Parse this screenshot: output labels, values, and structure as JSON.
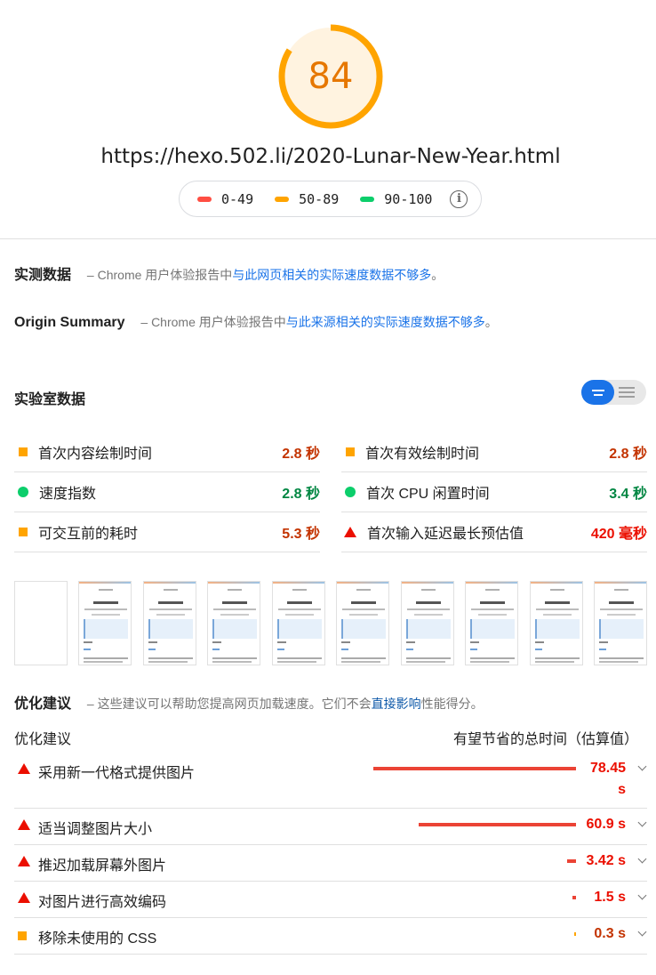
{
  "score": {
    "value": "84",
    "fraction": 0.84,
    "color": "#ffa400",
    "fill": "#fff3e0"
  },
  "url": "https://hexo.502.li/2020-Lunar-New-Year.html",
  "legend": [
    {
      "label": "0-49",
      "color": "#ff4e42"
    },
    {
      "label": "50-89",
      "color": "#ffa400"
    },
    {
      "label": "90-100",
      "color": "#0cce6b"
    }
  ],
  "field_data": {
    "title": "实测数据",
    "dash": "–",
    "text": "Chrome 用户体验报告中",
    "link": "与此网页相关的实际速度数据不够多",
    "end": "。"
  },
  "origin_summary": {
    "title": "Origin Summary",
    "dash": "–",
    "text": "Chrome 用户体验报告中",
    "link": "与此来源相关的实际速度数据不够多",
    "end": "。"
  },
  "lab_data": {
    "title": "实验室数据",
    "metrics_left": [
      {
        "label": "首次内容绘制时间",
        "value": "2.8 秒",
        "status": "average"
      },
      {
        "label": "速度指数",
        "value": "2.8 秒",
        "status": "pass"
      },
      {
        "label": "可交互前的耗时",
        "value": "5.3 秒",
        "status": "average"
      }
    ],
    "metrics_right": [
      {
        "label": "首次有效绘制时间",
        "value": "2.8 秒",
        "status": "average"
      },
      {
        "label": "首次 CPU 闲置时间",
        "value": "3.4 秒",
        "status": "pass"
      },
      {
        "label": "首次输入延迟最长预估值",
        "value": "420 毫秒",
        "status": "fail"
      }
    ]
  },
  "status_colors": {
    "average": "#ffa400",
    "pass": "#0cce6b",
    "fail": "#eb0f00",
    "average_text": "#c33300",
    "pass_text": "#018642",
    "fail_text": "#eb0f00"
  },
  "opportunities": {
    "title": "优化建议",
    "dash": "–",
    "desc_pre": "这些建议可以帮助您提高网页加载速度。它们不会",
    "desc_link": "直接影响",
    "desc_post": "性能得分。",
    "col_left": "优化建议",
    "col_right": "有望节省的总时间（估算值）",
    "items": [
      {
        "label": "采用新一代格式提供图片",
        "value": "78.45 s",
        "savings": 78.45,
        "status": "fail"
      },
      {
        "label": "适当调整图片大小",
        "value": "60.9 s",
        "savings": 60.9,
        "status": "fail"
      },
      {
        "label": "推迟加载屏幕外图片",
        "value": "3.42 s",
        "savings": 3.42,
        "status": "fail"
      },
      {
        "label": "对图片进行高效编码",
        "value": "1.5 s",
        "savings": 1.5,
        "status": "fail"
      },
      {
        "label": "移除未使用的 CSS",
        "value": "0.3 s",
        "savings": 0.3,
        "status": "average"
      }
    ]
  }
}
